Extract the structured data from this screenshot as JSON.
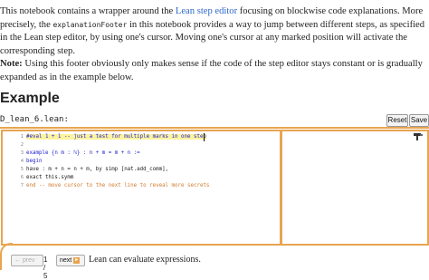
{
  "intro": {
    "p1_before_link": "This notebook contains a wrapper around the ",
    "link_text": "Lean step editor",
    "p1_after_link": " focusing on blockwise code explanations. More precisely, the ",
    "code_term": "explanationFooter",
    "p1_rest": " in this notebook provides a way to jump between different steps, as specified in the Lean step editor, by using one's cursor. Moving one's cursor at any marked position will activate the corresponding step.",
    "note_label": "Note:",
    "note_text": " Using this footer obviously only makes sense if the code of the step editor stays constant or is gradually expanded as in the example below."
  },
  "heading": "Example",
  "editor": {
    "filename": "D_lean_6.lean:",
    "reset_label": "Reset",
    "save_label": "Save",
    "lines": [
      {
        "num": "1",
        "text": "#eval 1 + 1 -- just a test for multiple marks in one step"
      },
      {
        "num": "2",
        "text": ""
      },
      {
        "num": "3",
        "text": "example {n m : ℕ} : n + m = m + n :="
      },
      {
        "num": "4",
        "text": "begin"
      },
      {
        "num": "5",
        "text": "have : m + n = n + m, by simp [nat.add_comm],"
      },
      {
        "num": "6",
        "text": "exact this.symm"
      },
      {
        "num": "7",
        "text": "end -- move cursor to the next line to reveal more secrets"
      }
    ]
  },
  "icons": {
    "panel_toolbar": "pin-icon",
    "next_arrow": "arrow-right-icon"
  },
  "footer": {
    "prev_label": "← prev",
    "page_counter": "1 / 5",
    "next_label": "next",
    "message": "Lean can evaluate expressions."
  },
  "colors": {
    "accent": "#e8a550",
    "link": "#2c66c8",
    "keyword": "#2020d0",
    "comment": "#d07a2c",
    "highlight": "#fbf3a0"
  }
}
